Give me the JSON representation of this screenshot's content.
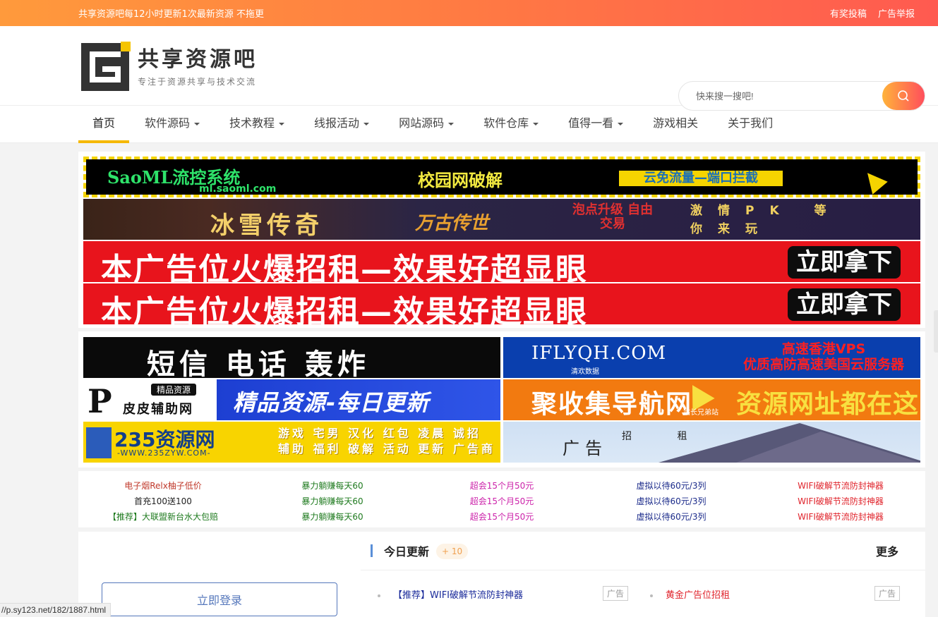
{
  "topbar": {
    "notice": "共享资源吧每12小时更新1次最新资源 不拖更",
    "links": [
      "有奖投稿",
      "广告举报"
    ]
  },
  "logo": {
    "name": "共享资源吧",
    "slogan": "专注于资源共享与技术交流"
  },
  "search": {
    "placeholder": "快来搜一搜吧!"
  },
  "nav": {
    "items": [
      {
        "label": "首页",
        "dropdown": false,
        "active": true
      },
      {
        "label": "软件源码",
        "dropdown": true
      },
      {
        "label": "技术教程",
        "dropdown": true
      },
      {
        "label": "线报活动",
        "dropdown": true
      },
      {
        "label": "网站源码",
        "dropdown": true
      },
      {
        "label": "软件仓库",
        "dropdown": true
      },
      {
        "label": "值得一看",
        "dropdown": true
      },
      {
        "label": "游戏相关",
        "dropdown": false
      },
      {
        "label": "关于我们",
        "dropdown": false
      }
    ]
  },
  "banners": {
    "saoml": {
      "title": "SaoML流控系统",
      "domain": "ml.saoml.com",
      "mid": "校园网破解",
      "right": "云免流量—端口拦截"
    },
    "bingxue": {
      "title": "冰雪传奇",
      "logo": "万古传世",
      "feature": "泡点升级 自由交易",
      "slogan": "激情PK 等你来玩"
    },
    "rent1": {
      "text": "本广告位火爆招租—效果好超显眼",
      "cta": "立即拿下"
    },
    "rent2": {
      "text": "本广告位火爆招租—效果好超显眼",
      "cta": "立即拿下"
    }
  },
  "grid_ads": {
    "sms": {
      "text": "短信 电话 轰炸"
    },
    "iflyqh": {
      "domain": "IFLYQH.COM",
      "sub": "清欢数据",
      "line1": "高速香港VPS",
      "line2": "优质高防高速美国云服务器"
    },
    "pipi": {
      "letter": "P",
      "tag": "精品资源",
      "name": "皮皮辅助网",
      "slogan": "精品资源-每日更新"
    },
    "jushouji": {
      "name": "聚收集导航网",
      "sub": "站长兄弟站",
      "slogan": "资源网址都在这里"
    },
    "zyw235": {
      "name": "235资源网",
      "domain": "-WWW.235ZYW.COM-",
      "line1": "游戏 宅男 汉化 红包 凌晨 诚招",
      "line2": "辅助 福利 破解 活动 更新 广告商"
    },
    "rent": {
      "big": "广告",
      "small": "招 租"
    }
  },
  "textlinks": {
    "columns": [
      {
        "color": "#c0392b",
        "items": [
          "电子烟Relx柚子低价",
          "首充100送100",
          "【推荐】大联盟新台水大包赔"
        ],
        "colors": [
          "#c0392b",
          "#222222",
          "#1e7a1e"
        ]
      },
      {
        "color": "#1e7a1e",
        "items": [
          "暴力躺赚每天60",
          "暴力躺赚每天60",
          "暴力躺赚每天60"
        ],
        "colors": [
          "#1e7a1e",
          "#1e7a1e",
          "#1e7a1e"
        ]
      },
      {
        "color": "#cc22aa",
        "items": [
          "超会15个月50元",
          "超会15个月50元",
          "超会15个月50元"
        ],
        "colors": [
          "#cc22aa",
          "#cc22aa",
          "#cc22aa"
        ]
      },
      {
        "color": "#1a2a8a",
        "items": [
          "虚拟以待60元/3列",
          "虚拟以待60元/3列",
          "虚拟以待60元/3列"
        ],
        "colors": [
          "#1a2a8a",
          "#1a2a8a",
          "#1a2a8a"
        ]
      },
      {
        "color": "#e0242c",
        "items": [
          "WIFI破解节流防封神器",
          "WIFI破解节流防封神器",
          "WIFI破解节流防封神器"
        ],
        "colors": [
          "#e0242c",
          "#e0242c",
          "#e0242c"
        ]
      }
    ]
  },
  "login": {
    "button": "立即登录"
  },
  "today": {
    "title": "今日更新",
    "count": "+ 10",
    "more": "更多",
    "items": [
      {
        "text": "【推荐】WIFI破解节流防封神器",
        "tag": "广告",
        "color": "#1a2a9a"
      },
      {
        "text": "黄金广告位招租",
        "tag": "广告",
        "color": "#e0242c"
      }
    ]
  },
  "statusbar": {
    "url": "//p.sy123.net/182/1887.html"
  },
  "colors": {
    "accent": "#f5b800",
    "topbar_start": "#ff9a3c",
    "topbar_end": "#ff5a50"
  }
}
